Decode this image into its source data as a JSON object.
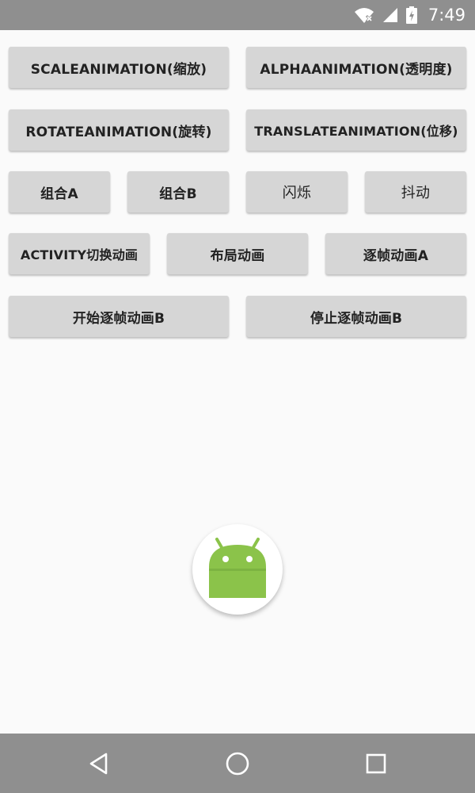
{
  "status_bar": {
    "time": "7:49",
    "icons": [
      "wifi-no-signal-icon",
      "cellular-signal-icon",
      "battery-charging-icon"
    ]
  },
  "buttons": {
    "scale": "SCALEANIMATION(缩放)",
    "alpha": "ALPHAANIMATION(透明度)",
    "rotate": "ROTATEANIMATION(旋转)",
    "translate": "TRANSLATEANIMATION(位移)",
    "combo_a": "组合A",
    "combo_b": "组合B",
    "blink": "闪烁",
    "shake": "抖动",
    "activity_switch": "ACTIVITY切换动画",
    "layout": "布局动画",
    "frame_a": "逐帧动画A",
    "start_frame_b": "开始逐帧动画B",
    "stop_frame_b": "停止逐帧动画B"
  },
  "image": {
    "icon": "android-robot-icon",
    "colors": {
      "android_green": "#8bc34a",
      "circle": "#ffffff"
    }
  },
  "nav_bar": {
    "icons": [
      "back-icon",
      "home-icon",
      "recents-icon"
    ]
  },
  "colors": {
    "bars": "#8f8f8f",
    "background": "#fafafa",
    "button": "#d6d6d6",
    "button_text": "#222222"
  }
}
